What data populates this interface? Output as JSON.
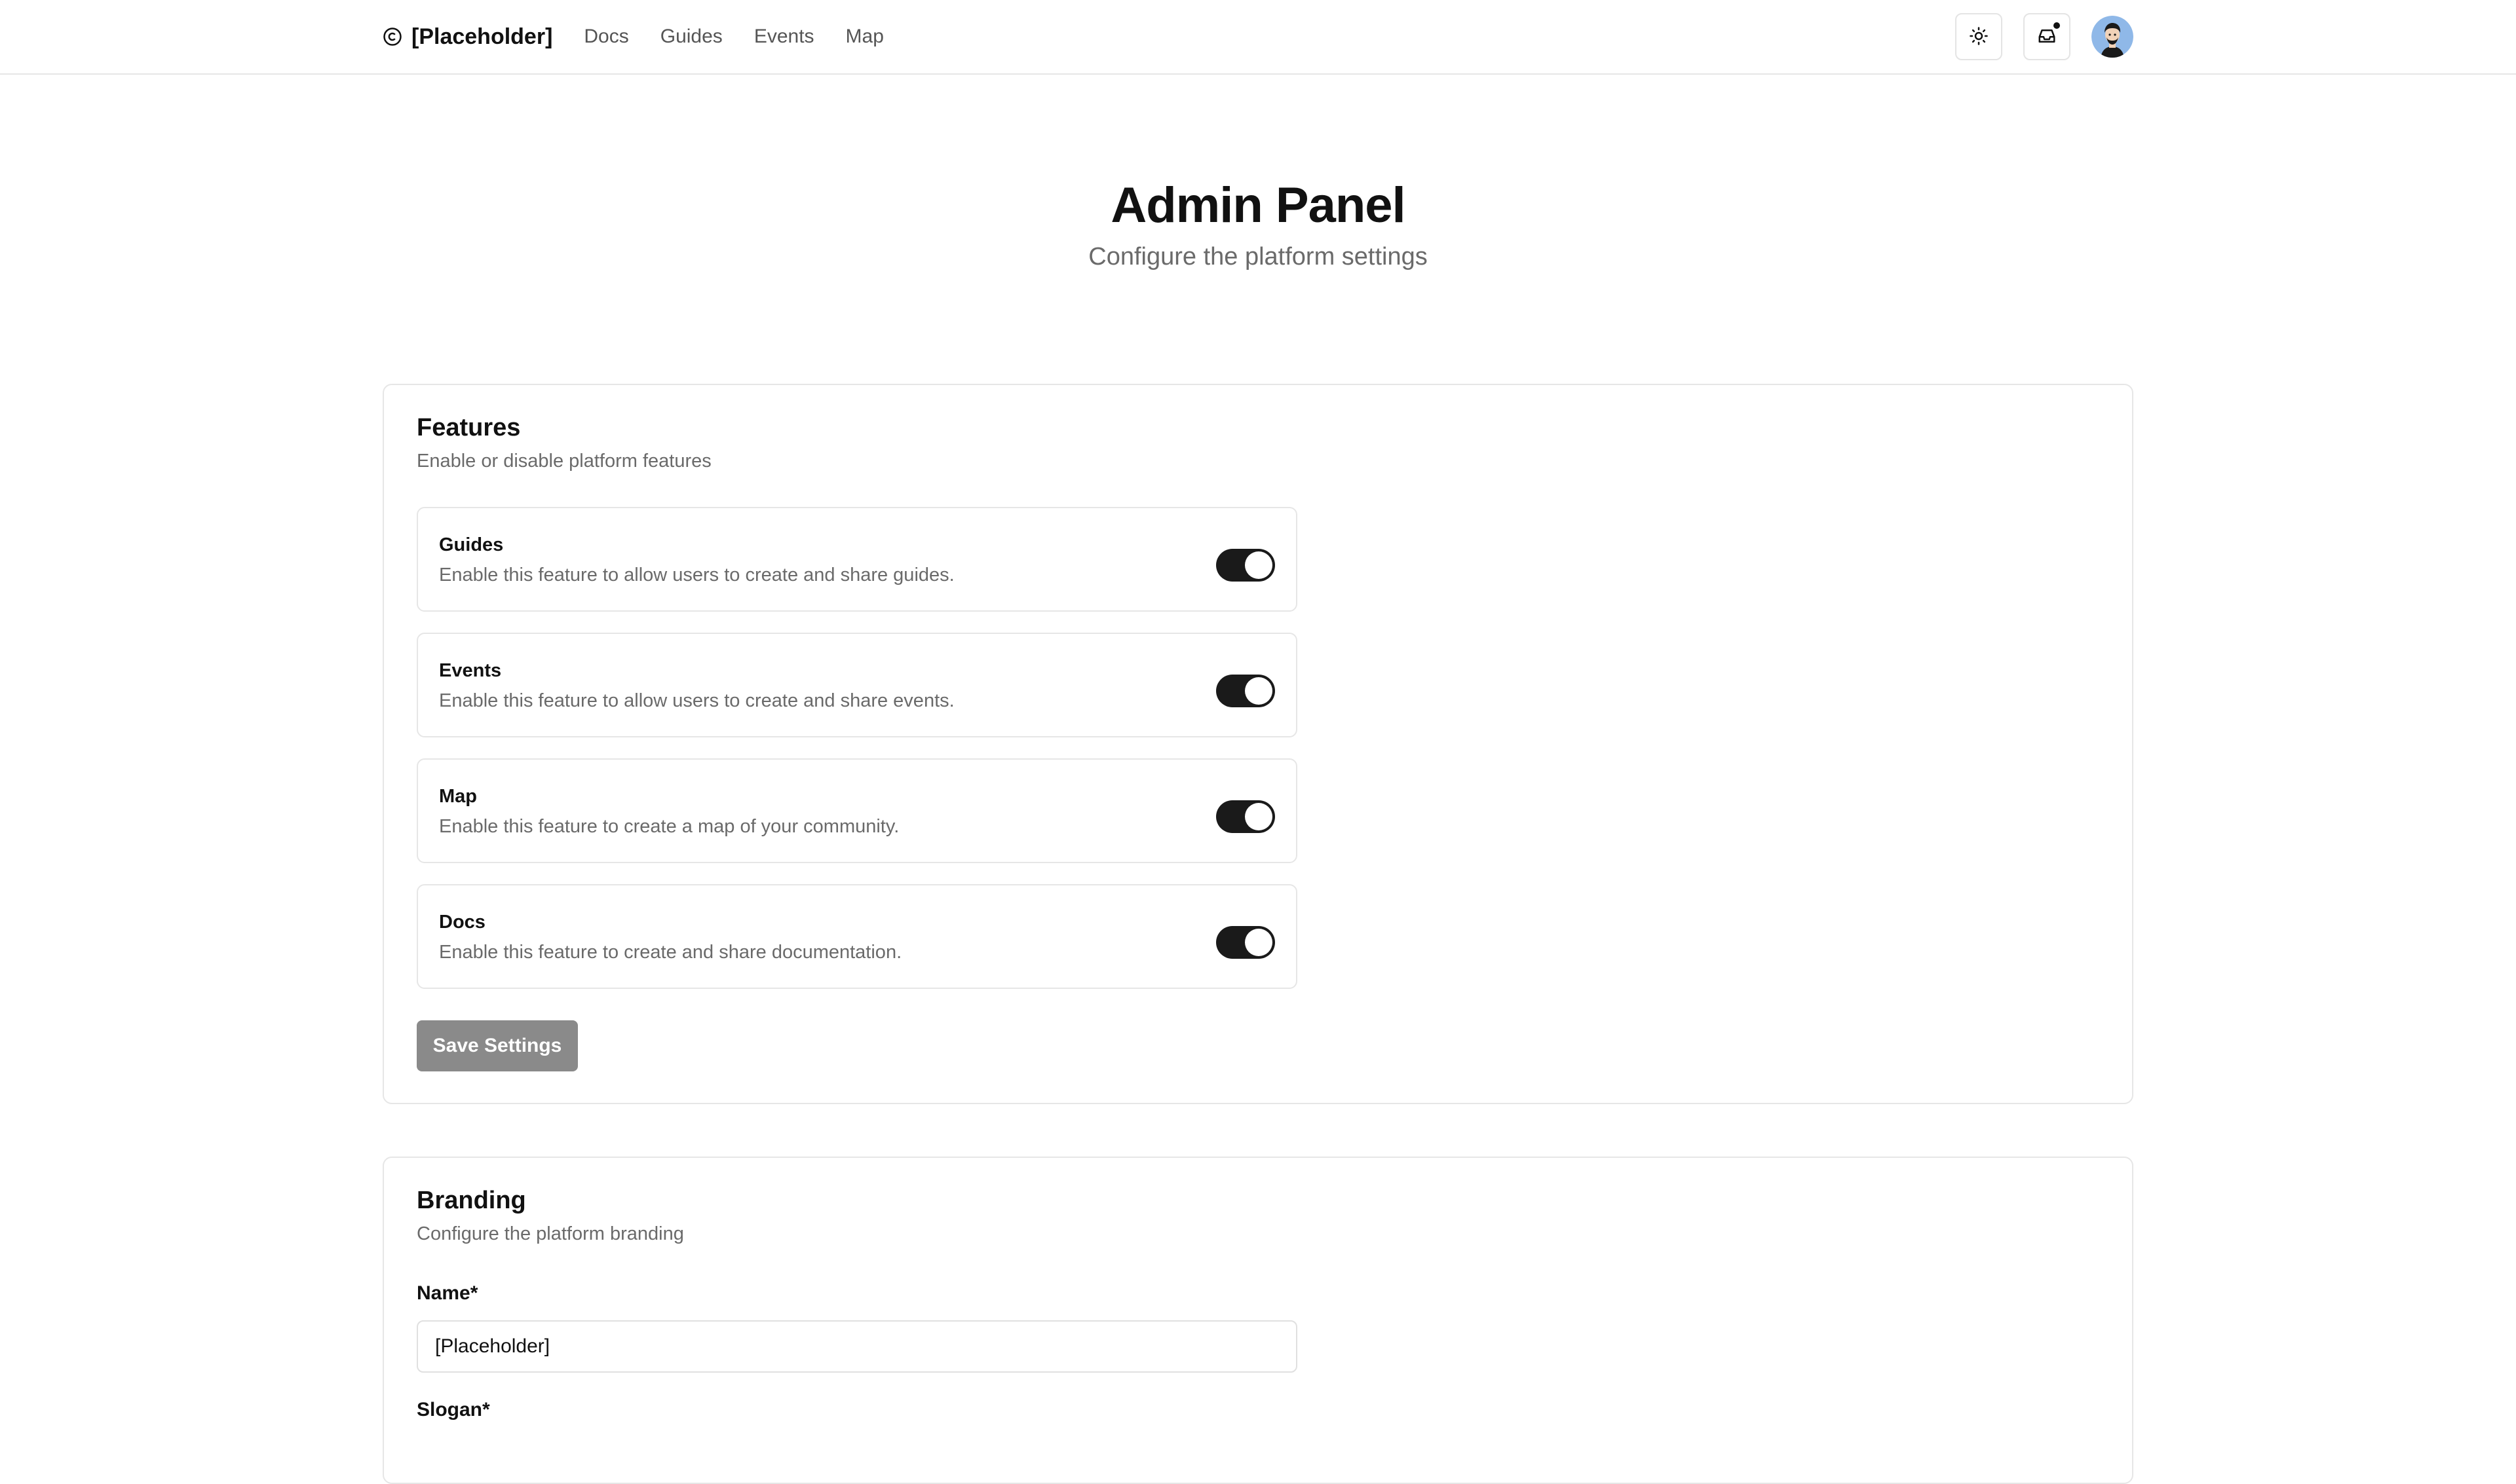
{
  "nav": {
    "brand": "[Placeholder]",
    "links": [
      "Docs",
      "Guides",
      "Events",
      "Map"
    ],
    "icons": {
      "brand": "copyright-circle-icon",
      "theme": "sun-icon",
      "inbox": "inbox-icon"
    }
  },
  "header": {
    "title": "Admin Panel",
    "subtitle": "Configure the platform settings"
  },
  "features": {
    "title": "Features",
    "description": "Enable or disable platform features",
    "items": [
      {
        "name": "Guides",
        "description": "Enable this feature to allow users to create and share guides.",
        "enabled": true
      },
      {
        "name": "Events",
        "description": "Enable this feature to allow users to create and share events.",
        "enabled": true
      },
      {
        "name": "Map",
        "description": "Enable this feature to create a map of your community.",
        "enabled": true
      },
      {
        "name": "Docs",
        "description": "Enable this feature to create and share documentation.",
        "enabled": true
      }
    ],
    "save_label": "Save Settings"
  },
  "branding": {
    "title": "Branding",
    "description": "Configure the platform branding",
    "name_label": "Name*",
    "name_value": "[Placeholder]",
    "slogan_label": "Slogan*"
  },
  "colors": {
    "toggle_on": "#1a1a1a",
    "save_button": "#8a8a8a",
    "border": "#e6e6e6",
    "muted_text": "#6a6a6a"
  }
}
